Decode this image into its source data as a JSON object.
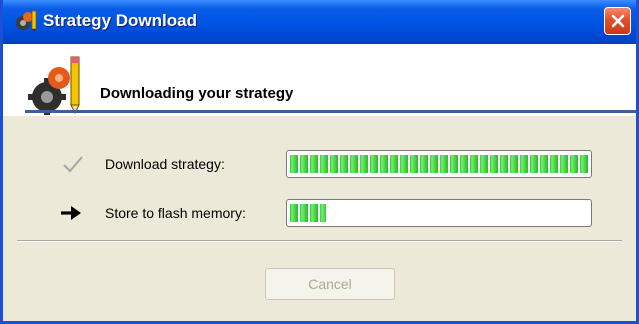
{
  "window": {
    "title": "Strategy Download"
  },
  "header": {
    "title": "Downloading your strategy"
  },
  "steps": [
    {
      "label": "Download strategy:",
      "status": "done",
      "progress": 1.0
    },
    {
      "label": "Store to flash memory:",
      "status": "in-progress",
      "progress": 0.12
    }
  ],
  "buttons": {
    "cancel": "Cancel",
    "cancel_enabled": false
  },
  "colors": {
    "titlebar": "#0054e3",
    "client_bg": "#ece9d8",
    "progress_green": "#3ec93e",
    "header_line": "#3a5f9e",
    "close_red": "#e1502a"
  },
  "icons": {
    "title": "gear-pencil-icon",
    "close": "close-icon",
    "header": "gears-pencil-icon",
    "done": "checkmark-icon",
    "current": "arrow-right-icon"
  }
}
